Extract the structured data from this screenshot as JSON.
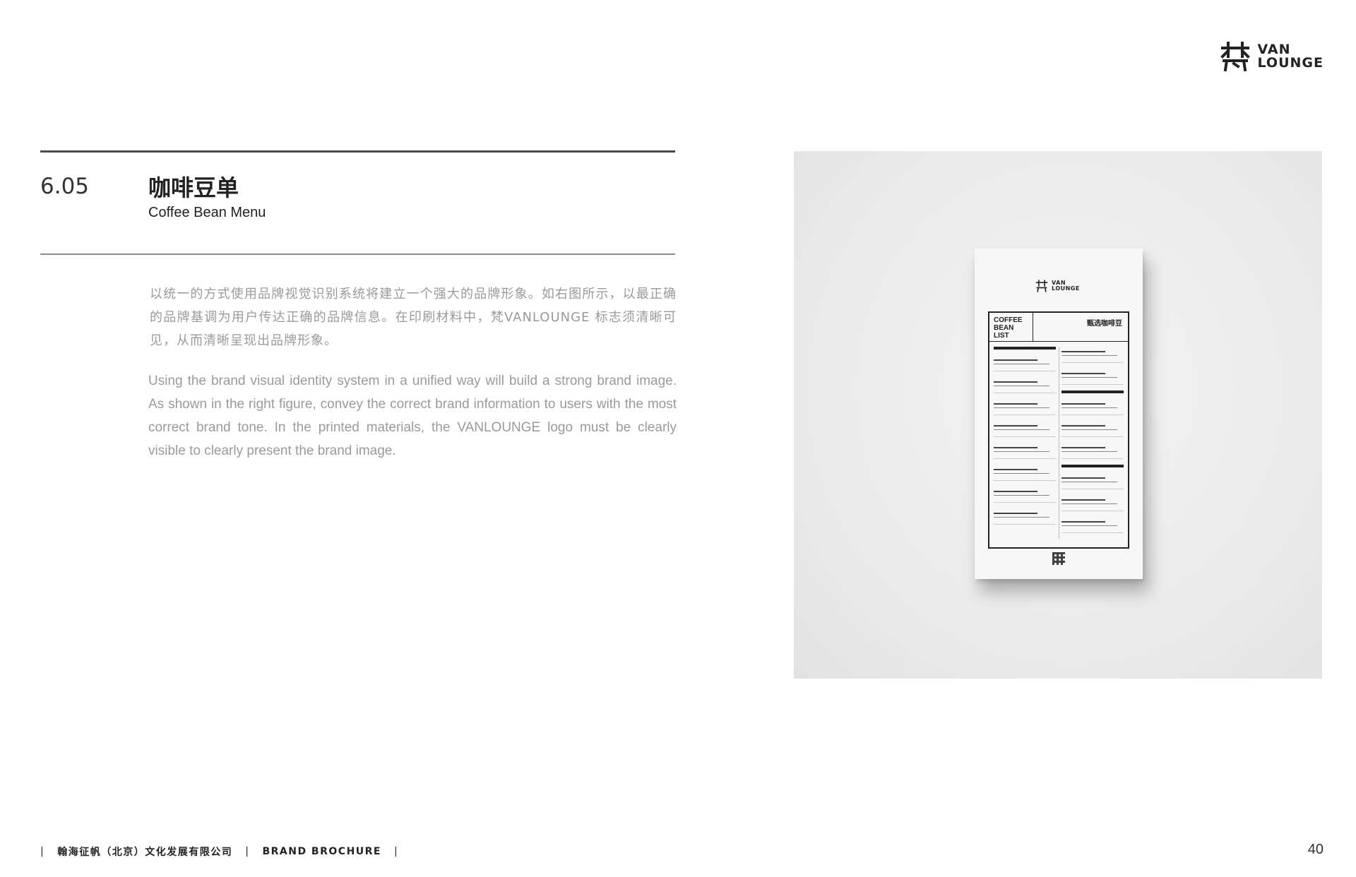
{
  "brand": {
    "logo_line1": "VAN",
    "logo_line2": "LOUNGE"
  },
  "section": {
    "number": "6.05",
    "title_cn": "咖啡豆单",
    "title_en": "Coffee Bean Menu"
  },
  "body": {
    "paragraph_cn": "以统一的方式使用品牌视觉识别系统将建立一个强大的品牌形象。如右图所示，以最正确的品牌基调为用户传达正确的品牌信息。在印刷材料中，梵VANLOUNGE  标志须清晰可见，从而清晰呈现出品牌形象。",
    "paragraph_en": "Using the brand visual identity system in a unified way will build a strong brand image. As shown in the right figure, convey the correct brand information to users with the most correct brand tone. In the printed materials, the VANLOUNGE logo must be clearly visible to clearly present the brand image."
  },
  "mockup": {
    "logo_line1": "VAN",
    "logo_line2": "LOUNGE",
    "heading_en": "COFFEE BEAN LIST",
    "heading_cn": "甄选咖啡豆"
  },
  "footer": {
    "company": "翰海征帆（北京）文化发展有限公司",
    "label": "BRAND BROCHURE",
    "separator": "|",
    "page": "40"
  }
}
